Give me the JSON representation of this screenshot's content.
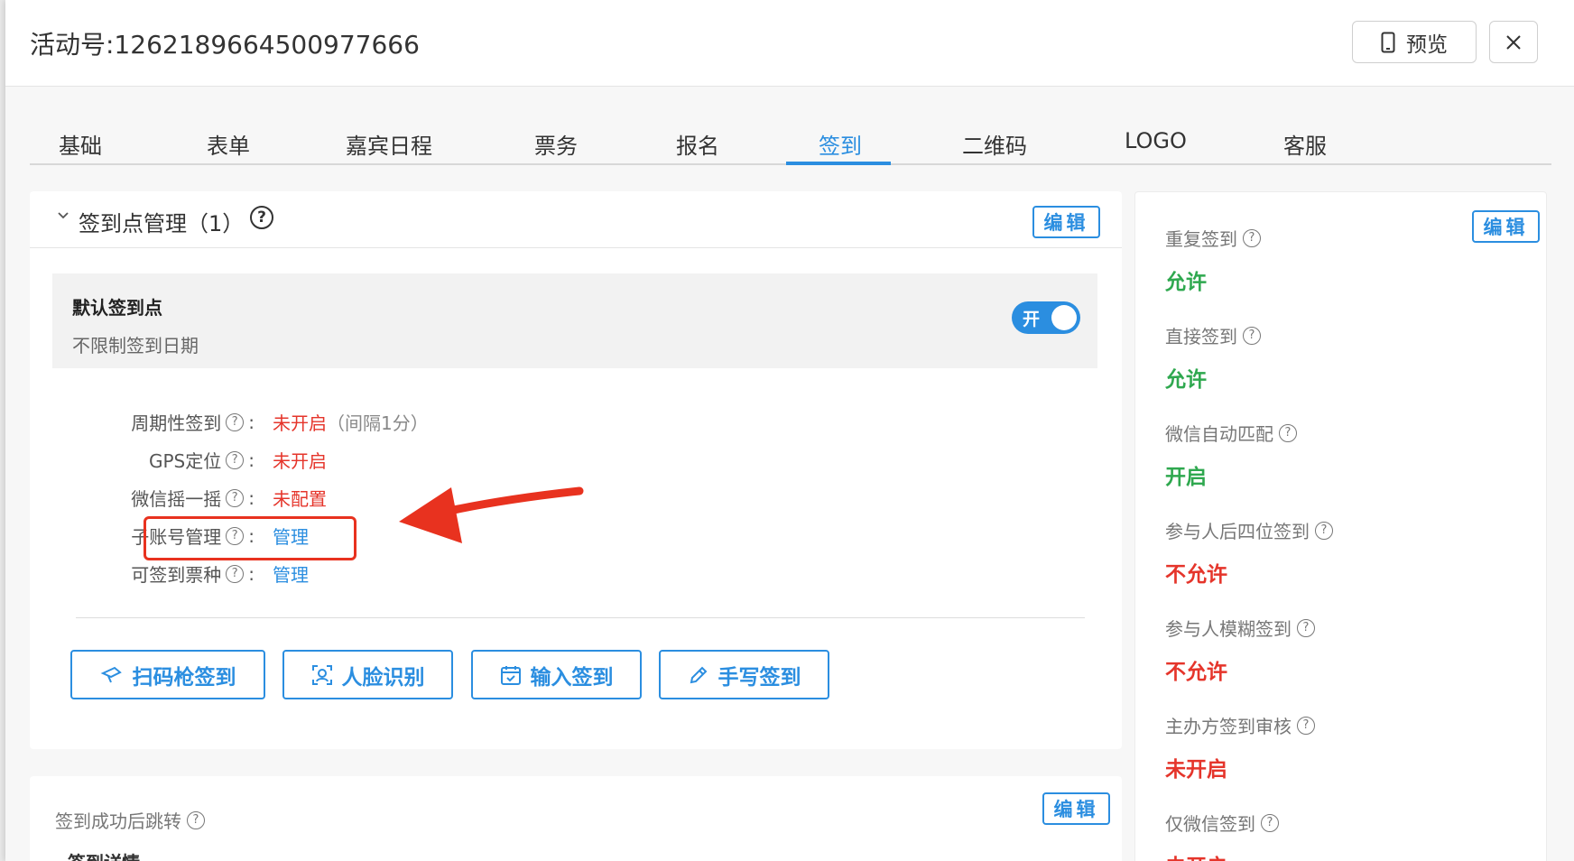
{
  "header": {
    "title": "活动号:1262189664500977666",
    "preview_label": "预览"
  },
  "tabs": [
    {
      "label": "基础"
    },
    {
      "label": "表单"
    },
    {
      "label": "嘉宾日程"
    },
    {
      "label": "票务"
    },
    {
      "label": "报名"
    },
    {
      "label": "签到",
      "active": true
    },
    {
      "label": "二维码"
    },
    {
      "label": "LOGO"
    },
    {
      "label": "客服"
    }
  ],
  "checkin_points": {
    "title": "签到点管理（1）",
    "edit_label": "编辑",
    "default_point": {
      "name": "默认签到点",
      "subtitle": "不限制签到日期",
      "toggle_label": "开",
      "enabled": true
    },
    "settings": [
      {
        "label": "周期性签到",
        "value": "未开启",
        "extra": "（间隔1分）"
      },
      {
        "label": "GPS定位",
        "value": "未开启"
      },
      {
        "label": "微信摇一摇",
        "value": "未配置"
      },
      {
        "label": "子账号管理",
        "value": "管理"
      },
      {
        "label": "可签到票种",
        "value": "管理"
      }
    ],
    "colon": ":",
    "actions": [
      {
        "label": "扫码枪签到",
        "icon": "scanner-icon"
      },
      {
        "label": "人脸识别",
        "icon": "face-icon"
      },
      {
        "label": "输入签到",
        "icon": "calendar-icon"
      },
      {
        "label": "手写签到",
        "icon": "pencil-icon"
      }
    ]
  },
  "redirect": {
    "title": "签到成功后跳转",
    "edit_label": "编辑",
    "subtitle": "签到详情"
  },
  "rules": {
    "edit_label": "编辑",
    "items": [
      {
        "label": "重复签到",
        "value": "允许",
        "status": "green"
      },
      {
        "label": "直接签到",
        "value": "允许",
        "status": "green"
      },
      {
        "label": "微信自动匹配",
        "value": "开启",
        "status": "green"
      },
      {
        "label": "参与人后四位签到",
        "value": "不允许",
        "status": "red"
      },
      {
        "label": "参与人模糊签到",
        "value": "不允许",
        "status": "red"
      },
      {
        "label": "主办方签到审核",
        "value": "未开启",
        "status": "red"
      },
      {
        "label": "仅微信签到",
        "value": "未开启",
        "status": "red"
      }
    ]
  },
  "colors": {
    "accent": "#2b8ee0",
    "danger": "#e5352b",
    "success": "#2fa84f",
    "annotation": "#e8321f"
  }
}
